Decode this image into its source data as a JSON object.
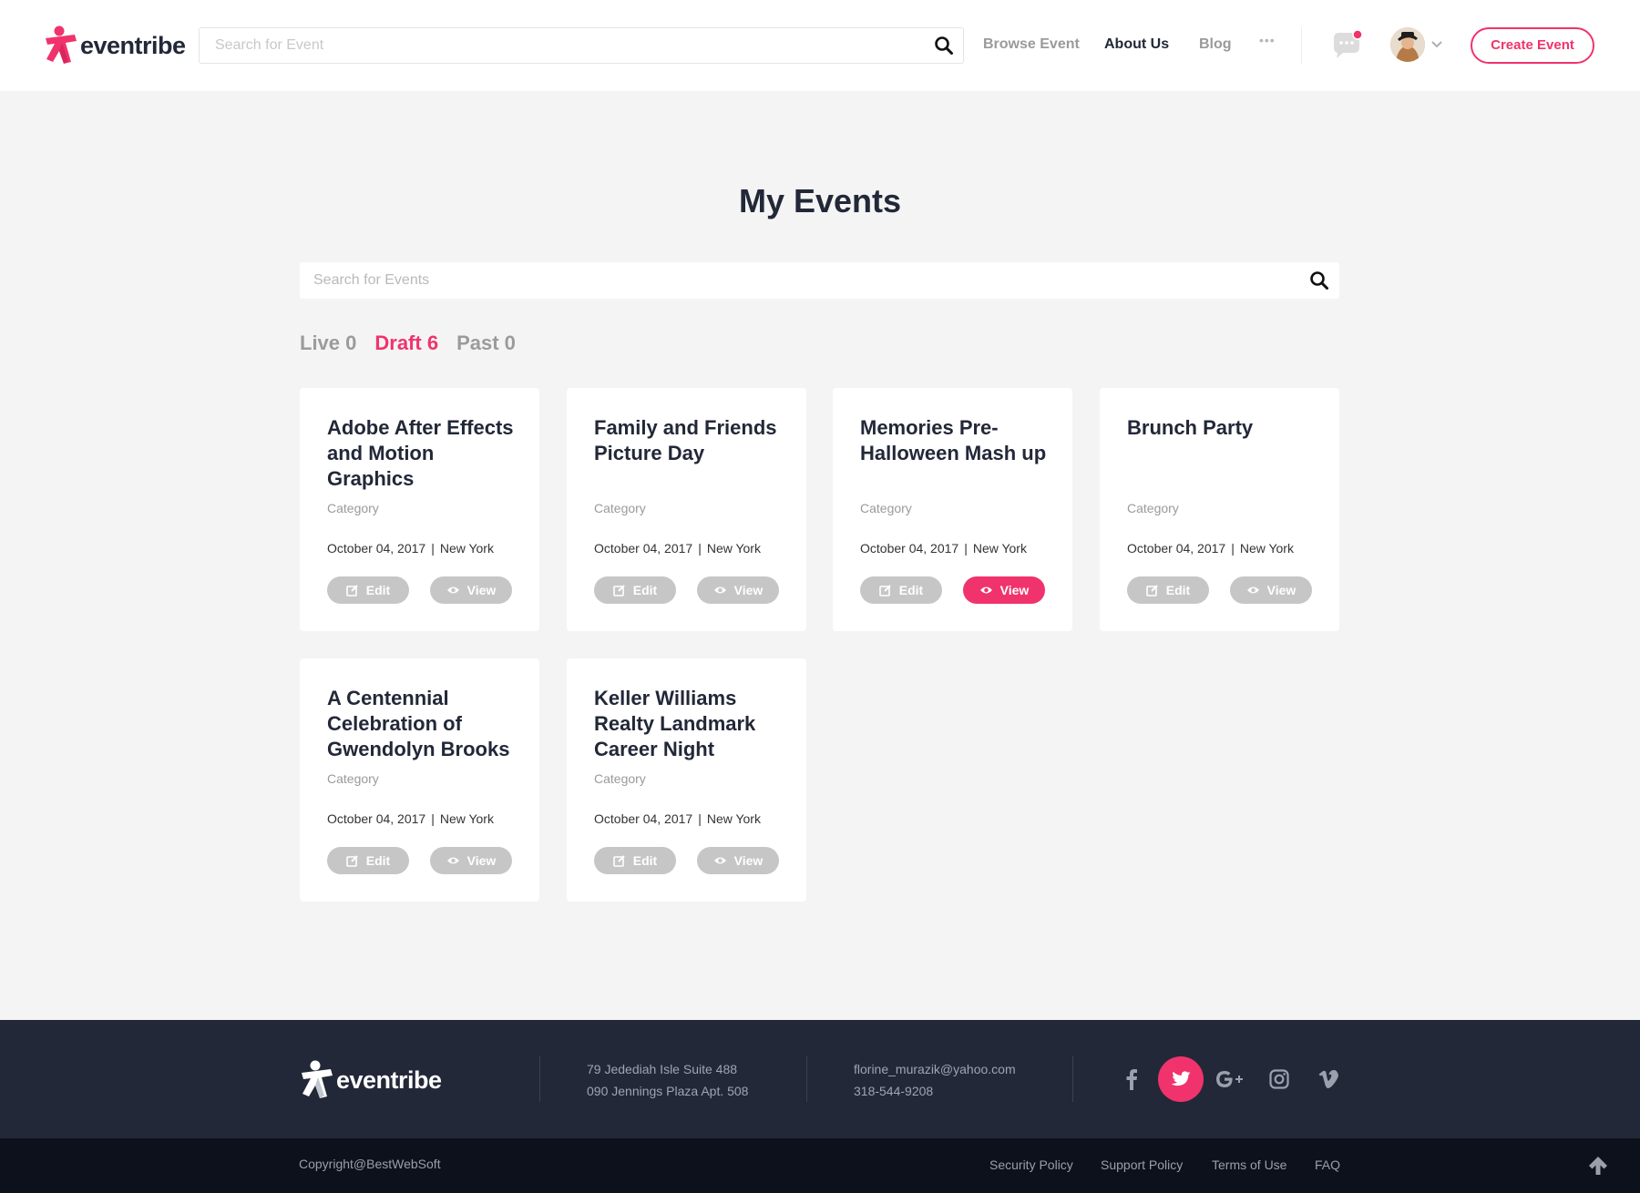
{
  "header": {
    "logo_text": "eventribe",
    "search_placeholder": "Search for Event",
    "nav": [
      {
        "label": "Browse Event",
        "active": false
      },
      {
        "label": "About Us",
        "active": true
      },
      {
        "label": "Blog",
        "active": false
      }
    ],
    "more_label": "•••",
    "create_label": "Create Event"
  },
  "main": {
    "title": "My Events",
    "search_placeholder": "Search for Events",
    "tabs": [
      {
        "label": "Live 0",
        "active": false
      },
      {
        "label": "Draft 6",
        "active": true
      },
      {
        "label": "Past 0",
        "active": false
      }
    ],
    "events": [
      {
        "title": "Adobe After Effects and Motion Graphics",
        "category": "Category",
        "date": "October 04, 2017",
        "city": "New York",
        "edit_label": "Edit",
        "view_label": "View"
      },
      {
        "title": "Family and Friends Picture Day",
        "category": "Category",
        "date": "October 04, 2017",
        "city": "New York",
        "edit_label": "Edit",
        "view_label": "View"
      },
      {
        "title": "Memories Pre-Halloween Mash up",
        "category": "Category",
        "date": "October 04, 2017",
        "city": "New York",
        "edit_label": "Edit",
        "view_label": "View"
      },
      {
        "title": "Brunch Party",
        "category": "Category",
        "date": "October 04, 2017",
        "city": "New York",
        "edit_label": "Edit",
        "view_label": "View"
      },
      {
        "title": "A Centennial Celebration of Gwendolyn Brooks",
        "category": "Category",
        "date": "October 04, 2017",
        "city": "New York",
        "edit_label": "Edit",
        "view_label": "View"
      },
      {
        "title": "Keller Williams Realty Landmark Career Night",
        "category": "Category",
        "date": "October 04, 2017",
        "city": "New York",
        "edit_label": "Edit",
        "view_label": "View"
      }
    ]
  },
  "footer": {
    "logo_text": "eventribe",
    "address_line1": "79 Jedediah Isle Suite 488",
    "address_line2": "090 Jennings Plaza Apt. 508",
    "email": "florine_murazik@yahoo.com",
    "phone": "318-544-9208",
    "copyright": "Copyright@BestWebSoft",
    "links": [
      "Security Policy",
      "Support Policy",
      "Terms of Use",
      "FAQ"
    ]
  },
  "colors": {
    "accent": "#f0336c",
    "dark": "#222838",
    "footer_bottom": "#0d111c",
    "button_gray": "#c6c6c6"
  },
  "icons": [
    "search-icon",
    "chat-icon",
    "chevron-down-icon",
    "edit-icon",
    "eye-icon",
    "facebook-icon",
    "twitter-icon",
    "google-plus-icon",
    "instagram-icon",
    "vimeo-icon",
    "arrow-up-icon"
  ]
}
